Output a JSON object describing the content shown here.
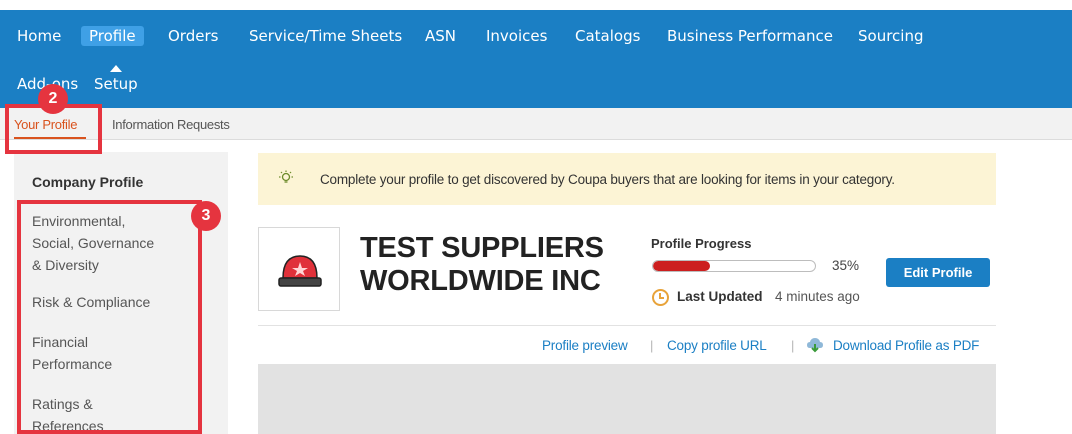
{
  "nav": {
    "items": [
      "Home",
      "Profile",
      "Orders",
      "Service/Time Sheets",
      "ASN",
      "Invoices",
      "Catalogs",
      "Business Performance",
      "Sourcing"
    ],
    "row2": [
      "Add-ons",
      "Setup"
    ],
    "active": "Profile",
    "accent_color": "#1b7fc4"
  },
  "subnav": {
    "tabs": [
      "Your Profile",
      "Information Requests"
    ],
    "active": "Your Profile"
  },
  "annotations": {
    "badge1": "2",
    "badge2": "3",
    "color": "#e5343f"
  },
  "sidebar": {
    "heading": "Company Profile",
    "items": [
      [
        "Environmental,",
        "Social, Governance",
        "& Diversity"
      ],
      [
        "Risk & Compliance"
      ],
      [
        "Financial",
        "Performance"
      ],
      [
        "Ratings &",
        "References"
      ]
    ]
  },
  "banner": {
    "icon": "lightbulb-icon",
    "text": "Complete your profile to get discovered by Coupa buyers that are looking for items in your category."
  },
  "company": {
    "name_line1": "TEST SUPPLIERS",
    "name_line2": "WORLDWIDE INC",
    "logo_icon": "siren-light-icon"
  },
  "progress": {
    "label": "Profile Progress",
    "percent_text": "35%",
    "fraction": 0.35,
    "bar_color": "#cc1f1f"
  },
  "updated": {
    "label": "Last Updated",
    "time": "4 minutes ago",
    "icon": "clock-icon"
  },
  "actions": {
    "edit_profile": "Edit Profile",
    "profile_preview": "Profile preview",
    "copy_url": "Copy profile URL",
    "download_pdf": "Download Profile as PDF",
    "separator": "|"
  }
}
